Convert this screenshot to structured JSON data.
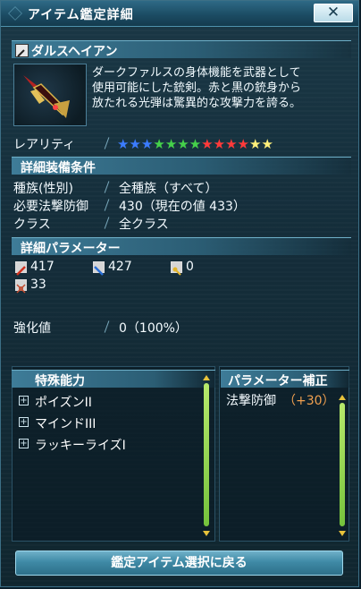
{
  "window": {
    "title": "アイテム鑑定詳細",
    "close_label": "✕"
  },
  "item": {
    "name": "ダルスヘイアン",
    "description_lines": [
      "ダークファルスの身体機能を武器として",
      "使用可能にした銃剣。赤と黒の銃身から",
      "放たれる光弾は驚異的な攻撃力を誇る。"
    ],
    "rarity_label": "レアリティ",
    "rarity_stars": 13,
    "rarity_colors": [
      "#3b7cff",
      "#3b7cff",
      "#3b7cff",
      "#45d14a",
      "#45d14a",
      "#45d14a",
      "#45d14a",
      "#ff3a3a",
      "#ff3a3a",
      "#ff3a3a",
      "#ff3a3a",
      "#fff07a",
      "#fff07a"
    ]
  },
  "requirements": {
    "header": "詳細装備条件",
    "rows": [
      {
        "label": "種族(性別)",
        "value": "全種族（すべて）"
      },
      {
        "label": "必要法撃防御",
        "value": "430（現在の値 433）"
      },
      {
        "label": "クラス",
        "value": "全クラス"
      }
    ]
  },
  "parameters": {
    "header": "詳細パラメーター",
    "stats": [
      {
        "icon": "striking-attack-icon",
        "value": "417"
      },
      {
        "icon": "ranged-attack-icon",
        "value": "427"
      },
      {
        "icon": "technique-attack-icon",
        "value": "0"
      },
      {
        "icon": "dexterity-icon",
        "value": "33"
      }
    ]
  },
  "enhancement": {
    "label": "強化値",
    "value": "0（100%）"
  },
  "special_abilities": {
    "header": "特殊能力",
    "items": [
      "ポイズンII",
      "マインドIII",
      "ラッキーライズI"
    ]
  },
  "param_bonus": {
    "header": "パラメーター補正",
    "label": "法撃防御",
    "value": "（+30）",
    "value_color": "#f0a050"
  },
  "footer": {
    "back_button": "鑑定アイテム選択に戻る"
  }
}
